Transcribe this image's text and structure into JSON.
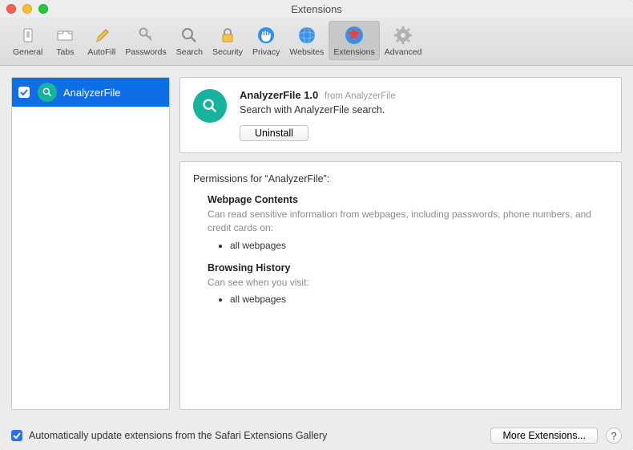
{
  "window": {
    "title": "Extensions"
  },
  "toolbar": {
    "items": [
      {
        "label": "General"
      },
      {
        "label": "Tabs"
      },
      {
        "label": "AutoFill"
      },
      {
        "label": "Passwords"
      },
      {
        "label": "Search"
      },
      {
        "label": "Security"
      },
      {
        "label": "Privacy"
      },
      {
        "label": "Websites"
      },
      {
        "label": "Extensions"
      },
      {
        "label": "Advanced"
      }
    ]
  },
  "sidebar": {
    "items": [
      {
        "name": "AnalyzerFile",
        "checked": true
      }
    ]
  },
  "details": {
    "title": "AnalyzerFile 1.0",
    "from_label": "from AnalyzerFile",
    "description": "Search with AnalyzerFile search.",
    "uninstall_label": "Uninstall"
  },
  "permissions": {
    "header": "Permissions for “AnalyzerFile”:",
    "sections": [
      {
        "title": "Webpage Contents",
        "desc": "Can read sensitive information from webpages, including passwords, phone numbers, and credit cards on:",
        "bullets": [
          "all webpages"
        ]
      },
      {
        "title": "Browsing History",
        "desc": "Can see when you visit:",
        "bullets": [
          "all webpages"
        ]
      }
    ]
  },
  "footer": {
    "auto_update_label": "Automatically update extensions from the Safari Extensions Gallery",
    "more_label": "More Extensions...",
    "help_label": "?"
  }
}
